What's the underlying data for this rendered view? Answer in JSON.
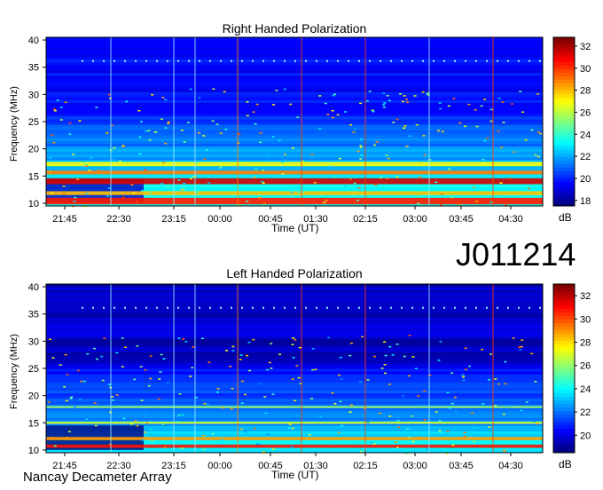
{
  "chart_data": [
    {
      "type": "heatmap",
      "title": "Right Handed Polarization",
      "xlabel": "Time (UT)",
      "ylabel": "Frequency (MHz)",
      "x_ticks": [
        "21:45",
        "22:30",
        "23:15",
        "00:00",
        "00:45",
        "01:30",
        "02:15",
        "03:00",
        "03:45",
        "04:30"
      ],
      "y_ticks": [
        10,
        15,
        20,
        25,
        30,
        35,
        40
      ],
      "ylim": [
        9.5,
        40.5
      ],
      "colorbar": {
        "ticks": [
          18,
          20,
          22,
          24,
          26,
          28,
          30,
          32
        ],
        "unit": "dB",
        "range": [
          17.5,
          32.8
        ]
      },
      "colormap": [
        "#00007f",
        "#0000ff",
        "#007fff",
        "#00ffff",
        "#7fff7f",
        "#ffff00",
        "#ff7f00",
        "#ff0000",
        "#7f0000"
      ],
      "bands": [
        {
          "f0": 9.8,
          "f1": 11.0,
          "level": 30.5
        },
        {
          "f0": 11.5,
          "f1": 12.2,
          "level": 28
        },
        {
          "f0": 13.5,
          "f1": 14.6,
          "level": 31.5
        },
        {
          "f0": 15.3,
          "f1": 16.0,
          "level": 29
        },
        {
          "f0": 16.8,
          "f1": 17.6,
          "level": 27
        }
      ]
    },
    {
      "type": "heatmap",
      "title": "Left Handed Polarization",
      "xlabel": "Time (UT)",
      "ylabel": "Frequency (MHz)",
      "x_ticks": [
        "21:45",
        "22:30",
        "23:15",
        "00:00",
        "00:45",
        "01:30",
        "02:15",
        "03:00",
        "03:45",
        "04:30"
      ],
      "y_ticks": [
        10,
        15,
        20,
        25,
        30,
        35,
        40
      ],
      "ylim": [
        9.5,
        40.5
      ],
      "colorbar": {
        "ticks": [
          20,
          22,
          24,
          26,
          28,
          30,
          32
        ],
        "unit": "dB",
        "range": [
          18.5,
          33
        ]
      },
      "colormap": [
        "#00007f",
        "#0000ff",
        "#007fff",
        "#00ffff",
        "#7fff7f",
        "#ffff00",
        "#ff7f00",
        "#ff0000",
        "#7f0000"
      ],
      "bands": [
        {
          "f0": 10.4,
          "f1": 11.0,
          "level": 31
        },
        {
          "f0": 11.8,
          "f1": 12.4,
          "level": 29
        },
        {
          "f0": 14.8,
          "f1": 15.2,
          "level": 27
        },
        {
          "f0": 17.7,
          "f1": 18.1,
          "level": 26
        }
      ]
    }
  ],
  "observation_id": "J011214",
  "footer": "Nancay Decameter Array"
}
